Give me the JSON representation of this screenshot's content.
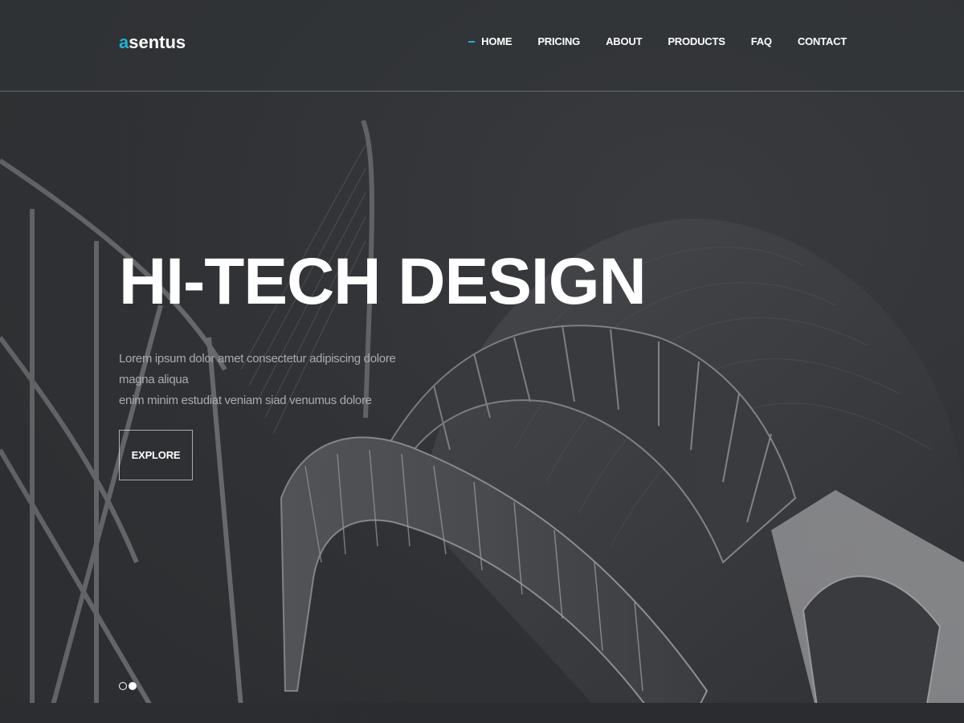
{
  "brand": {
    "logo_accent": "a",
    "logo_rest": "sentus",
    "accent_color": "#20b2d2"
  },
  "nav": {
    "items": [
      {
        "label": "HOME",
        "active": true
      },
      {
        "label": "PRICING"
      },
      {
        "label": "ABOUT"
      },
      {
        "label": "PRODUCTS"
      },
      {
        "label": "FAQ"
      },
      {
        "label": "CONTACT"
      }
    ]
  },
  "hero": {
    "title": "HI-TECH DESIGN",
    "subtitle_line1": "Lorem ipsum dolor amet consectetur adipiscing dolore magna aliqua",
    "subtitle_line2": "enim minim estudiat veniam siad venumus dolore",
    "cta_label": "EXPLORE",
    "background_image": "futuristic-architecture-photo"
  },
  "slider": {
    "slide_count": 2,
    "active_index": 1
  }
}
